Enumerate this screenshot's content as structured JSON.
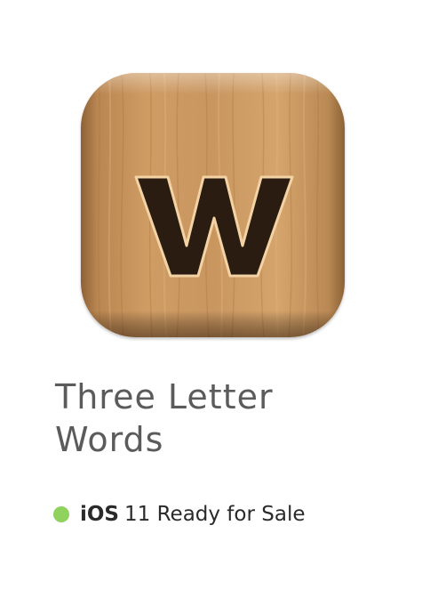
{
  "app": {
    "name": "Three Letter Words",
    "icon_glyph": "W",
    "icon_name": "wooden-tile-w-icon"
  },
  "status": {
    "platform": "iOS",
    "text": "11 Ready for Sale",
    "dot_color": "#8fd35e"
  },
  "colors": {
    "wood_light": "#d4a16a",
    "wood_mid": "#b98650",
    "wood_dark": "#8a5a2e",
    "glyph": "#2a1c10"
  }
}
